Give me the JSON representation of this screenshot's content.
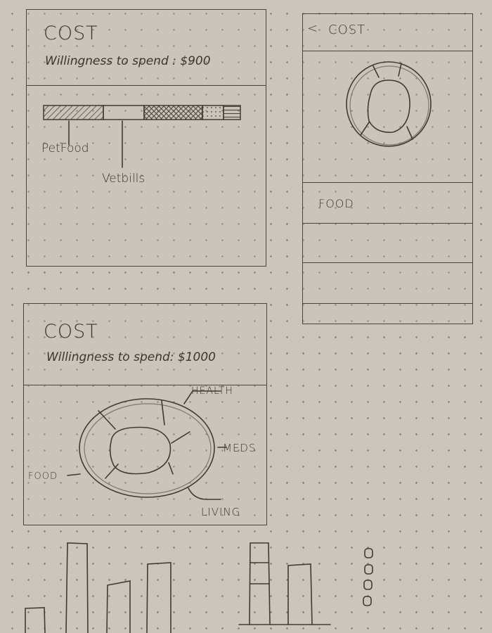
{
  "frame1": {
    "title": "COST",
    "subtitle": "Willingness to spend : $900",
    "labels": {
      "pet_food": "PetFood",
      "vet_bills": "Vetbills"
    }
  },
  "frame2": {
    "back_glyph": "<",
    "title": "COST",
    "food_label": "FOOD"
  },
  "frame3": {
    "title": "COST",
    "subtitle": "Willingness to spend: $1000",
    "labels": {
      "health": "HEALTH",
      "meds": "MEDS",
      "food": "FOOD",
      "living": "LIVING"
    }
  }
}
